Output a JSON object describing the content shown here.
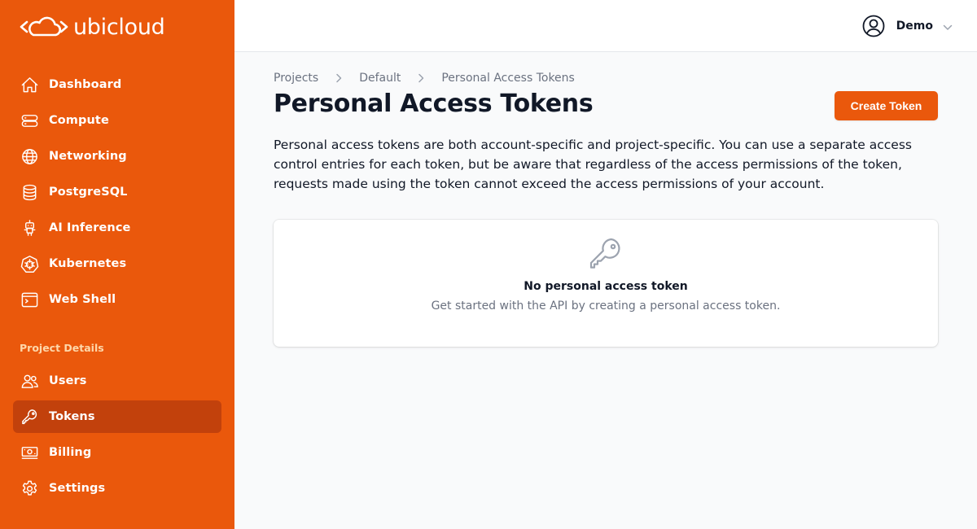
{
  "brand": {
    "name": "ubicloud",
    "accent": "#ea580c",
    "active_bg": "#c2410c"
  },
  "sidebar": {
    "items": [
      {
        "label": "Dashboard",
        "icon": "home-icon"
      },
      {
        "label": "Compute",
        "icon": "server-icon"
      },
      {
        "label": "Networking",
        "icon": "globe-icon"
      },
      {
        "label": "PostgreSQL",
        "icon": "database-icon"
      },
      {
        "label": "AI Inference",
        "icon": "robot-icon"
      },
      {
        "label": "Kubernetes",
        "icon": "kubernetes-icon"
      },
      {
        "label": "Web Shell",
        "icon": "terminal-icon"
      }
    ],
    "section_title": "Project Details",
    "project_items": [
      {
        "label": "Users",
        "icon": "users-icon"
      },
      {
        "label": "Tokens",
        "icon": "key-icon",
        "active": true
      },
      {
        "label": "Billing",
        "icon": "banknotes-icon"
      },
      {
        "label": "Settings",
        "icon": "gear-icon"
      }
    ]
  },
  "header": {
    "user_name": "Demo"
  },
  "breadcrumb": [
    "Projects",
    "Default",
    "Personal Access Tokens"
  ],
  "page": {
    "title": "Personal Access Tokens",
    "create_button": "Create Token",
    "description": "Personal access tokens are both account-specific and project-specific. You can use a separate access control entries for each token, but be aware that regardless of the access permissions of the token, requests made using the token cannot exceed the access permissions of your account."
  },
  "empty_state": {
    "icon": "key-icon",
    "title": "No personal access token",
    "subtitle": "Get started with the API by creating a personal access token."
  }
}
